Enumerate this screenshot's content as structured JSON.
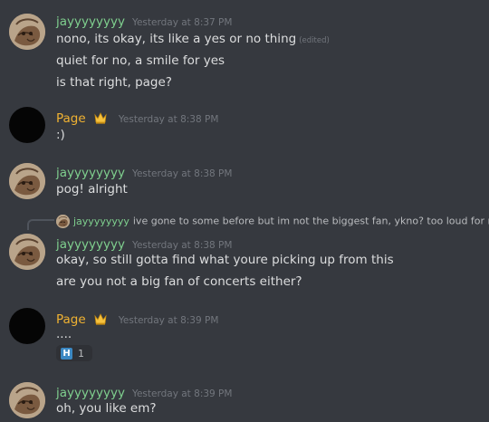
{
  "messages": [
    {
      "author": "jayyyyyyyy",
      "timestamp": "Yesterday at 8:37 PM",
      "lines": [
        "nono, its okay, its like a yes or no thing",
        "quiet for no, a smile for yes",
        "is that right, page?"
      ],
      "edited_label": "(edited)"
    },
    {
      "author": "Page",
      "timestamp": "Yesterday at 8:38 PM",
      "badge_icon": "crown-icon",
      "lines": [
        ":)"
      ]
    },
    {
      "author": "jayyyyyyyy",
      "timestamp": "Yesterday at 8:38 PM",
      "lines": [
        "pog! alright"
      ]
    },
    {
      "reply_to": {
        "author": "jayyyyyyyy",
        "text": "ive gone to some before but im not the biggest fan, ykno? too loud for me"
      },
      "author": "jayyyyyyyy",
      "timestamp": "Yesterday at 8:38 PM",
      "lines": [
        "okay, so still gotta find what youre picking up from this",
        "are you not a big fan of concerts either?"
      ]
    },
    {
      "author": "Page",
      "timestamp": "Yesterday at 8:39 PM",
      "badge_icon": "crown-icon",
      "lines": [
        "...."
      ],
      "reaction": {
        "emoji": "H",
        "count": "1"
      }
    },
    {
      "author": "jayyyyyyyy",
      "timestamp": "Yesterday at 8:39 PM",
      "lines": [
        "oh, you like em?"
      ]
    }
  ],
  "colors": {
    "background": "#36393f",
    "jay_name": "#7fcf8e",
    "page_name": "#f0b232",
    "timestamp": "#72767d",
    "text": "#dcddde"
  }
}
